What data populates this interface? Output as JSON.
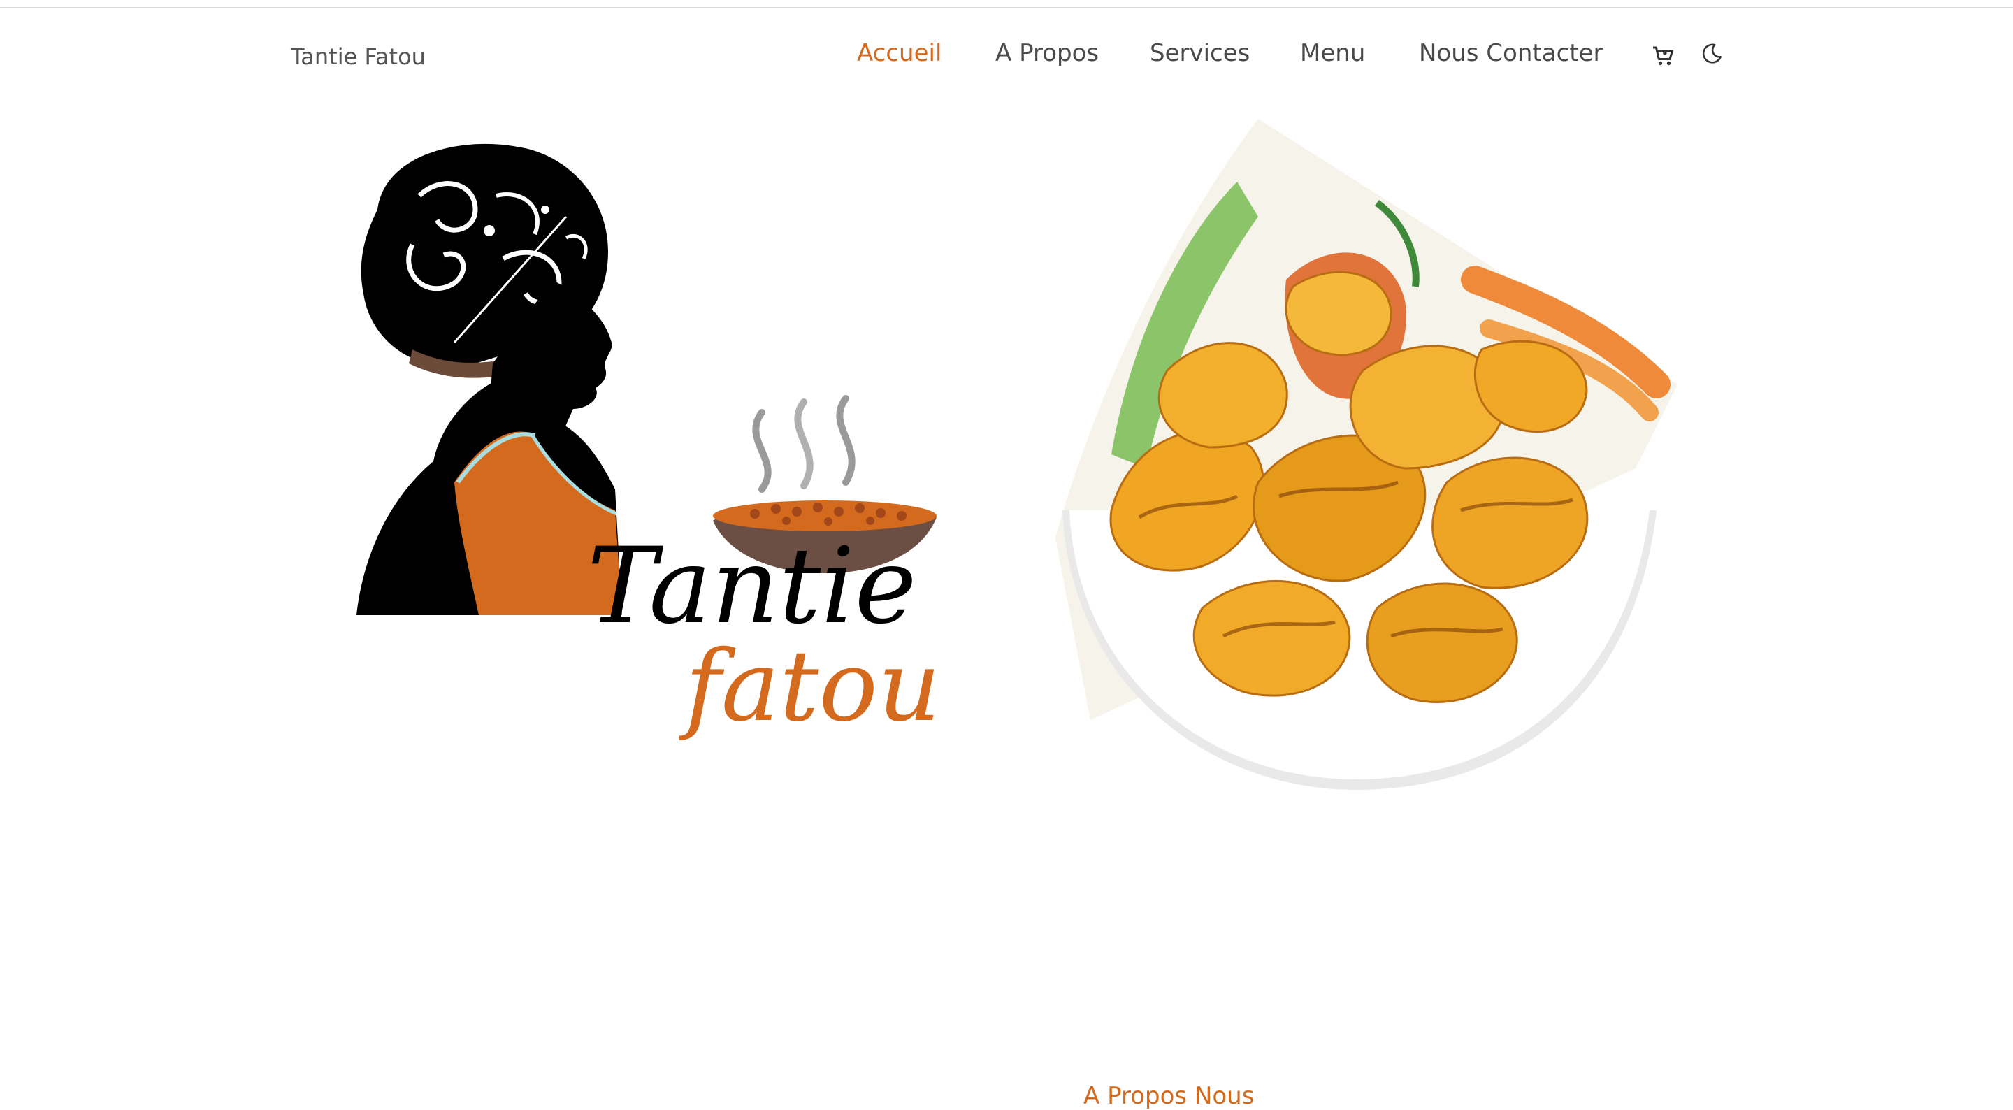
{
  "header": {
    "brand": "Tantie Fatou",
    "nav": [
      {
        "label": "Accueil",
        "active": true
      },
      {
        "label": "A Propos",
        "active": false
      },
      {
        "label": "Services",
        "active": false
      },
      {
        "label": "Menu",
        "active": false
      },
      {
        "label": "Nous Contacter",
        "active": false
      }
    ],
    "icons": [
      "cart-icon",
      "moon-icon"
    ]
  },
  "hero": {
    "logo_text_line1": "Tantie",
    "logo_text_line2": "fatou"
  },
  "about": {
    "heading": "A Propos Nous"
  },
  "colors": {
    "accent": "#d36a1e",
    "nav_text": "#4a4a4a",
    "brand_text": "#555555"
  }
}
